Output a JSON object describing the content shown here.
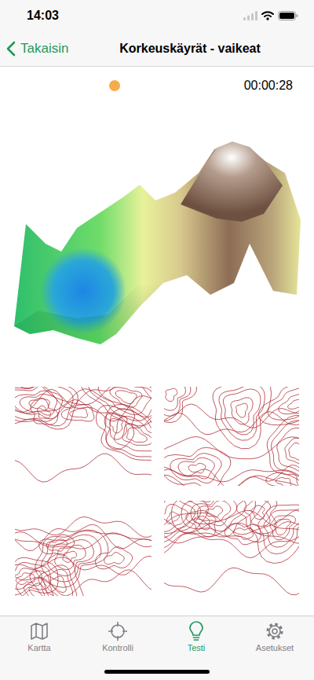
{
  "status_bar": {
    "time": "14:03"
  },
  "nav": {
    "back": "Takaisin",
    "title": "Korkeuskäyrät - vaikeat"
  },
  "quiz": {
    "indicator_color": "#f5ad4b",
    "timer": "00:00:28",
    "options": [
      {
        "selected": false
      },
      {
        "selected": false
      },
      {
        "selected": false
      },
      {
        "selected": false
      }
    ]
  },
  "tab_bar": {
    "items": [
      {
        "label": "Kartta",
        "selected": false
      },
      {
        "label": "Kontrolli",
        "selected": false
      },
      {
        "label": "Testi",
        "selected": true
      },
      {
        "label": "Asetukset",
        "selected": false
      }
    ]
  }
}
